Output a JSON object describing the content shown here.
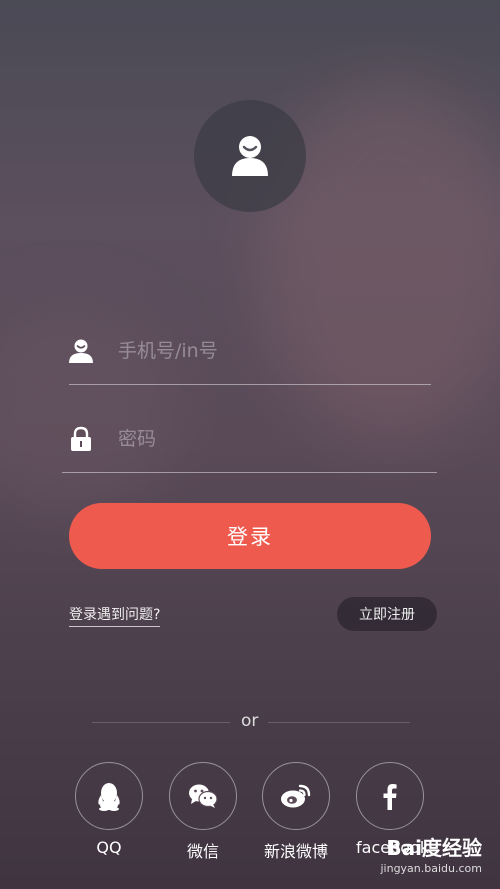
{
  "login": {
    "phone_placeholder": "手机号/in号",
    "password_placeholder": "密码",
    "login_button": "登录",
    "problem_link": "登录遇到问题?",
    "register_button": "立即注册"
  },
  "divider": {
    "text": "or"
  },
  "social": [
    {
      "label": "QQ",
      "icon": "qq-icon"
    },
    {
      "label": "微信",
      "icon": "wechat-icon"
    },
    {
      "label": "新浪微博",
      "icon": "weibo-icon"
    },
    {
      "label": "facebook",
      "icon": "facebook-icon"
    }
  ],
  "watermark": {
    "brand": "Bai度经验",
    "url": "jingyan.baidu.com"
  },
  "colors": {
    "accent": "#ef5a4f"
  }
}
